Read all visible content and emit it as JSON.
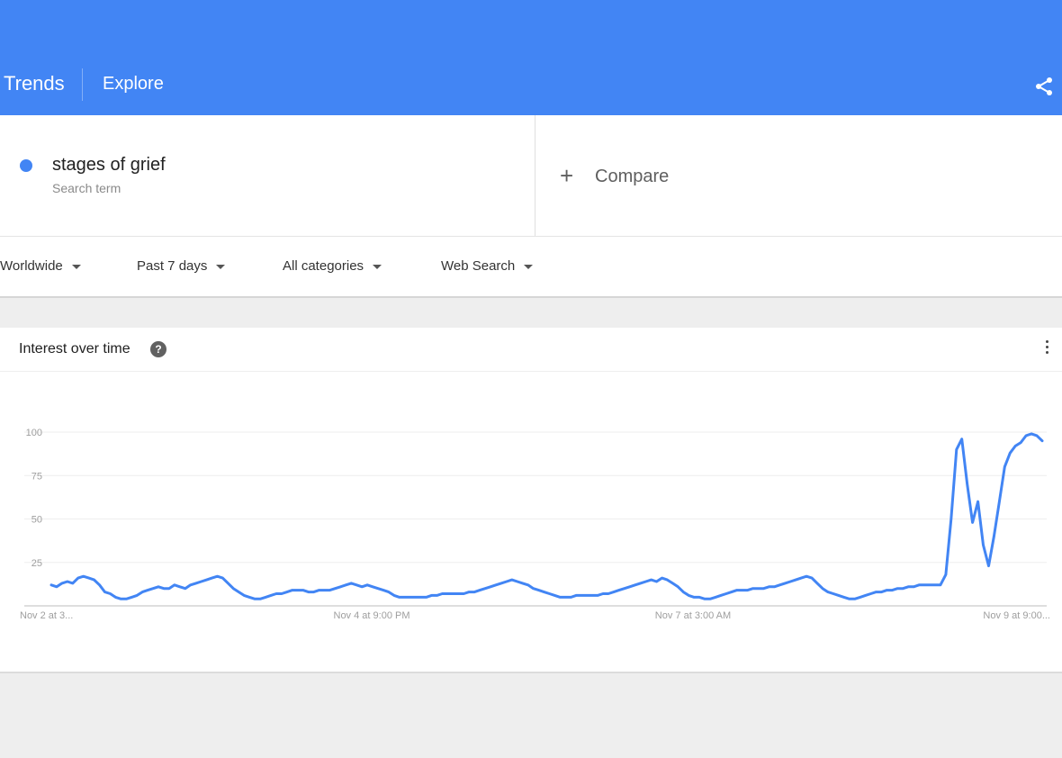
{
  "app": {
    "brand": "Trends",
    "nav_explore": "Explore"
  },
  "colors": {
    "header": "#4285f4",
    "series": "#4285f4"
  },
  "icons": {
    "share": "share-icon",
    "help": "help-icon",
    "more": "more-vert-icon",
    "add": "plus-icon",
    "dropdown": "caret-down-icon"
  },
  "search": {
    "term": "stages of grief",
    "term_type": "Search term",
    "compare_icon": "+",
    "compare_label": "Compare"
  },
  "filters": [
    {
      "label": "Worldwide"
    },
    {
      "label": "Past 7 days"
    },
    {
      "label": "All categories"
    },
    {
      "label": "Web Search"
    }
  ],
  "card": {
    "title": "Interest over time",
    "help_glyph": "?"
  },
  "chart_data": {
    "type": "line",
    "title": "Interest over time",
    "xlabel": "",
    "ylabel": "",
    "ylim": [
      0,
      100
    ],
    "yticks": [
      25,
      50,
      75,
      100
    ],
    "x_tick_labels": [
      "Nov 2 at 3...",
      "Nov 4 at 9:00 PM",
      "Nov 7 at 3:00 AM",
      "Nov 9 at 9:00..."
    ],
    "grid": true,
    "series": [
      {
        "values": [
          12,
          11,
          13,
          14,
          13,
          16,
          17,
          16,
          15,
          12,
          8,
          7,
          5,
          4,
          4,
          5,
          6,
          8,
          9,
          10,
          11,
          10,
          10,
          12,
          11,
          10,
          12,
          13,
          14,
          15,
          16,
          17,
          16,
          13,
          10,
          8,
          6,
          5,
          4,
          4,
          5,
          6,
          7,
          7,
          8,
          9,
          9,
          9,
          8,
          8,
          9,
          9,
          9,
          10,
          11,
          12,
          13,
          12,
          11,
          12,
          11,
          10,
          9,
          8,
          6,
          5,
          5,
          5,
          5,
          5,
          5,
          6,
          6,
          7,
          7,
          7,
          7,
          7,
          8,
          8,
          9,
          10,
          11,
          12,
          13,
          14,
          15,
          14,
          13,
          12,
          10,
          9,
          8,
          7,
          6,
          5,
          5,
          5,
          6,
          6,
          6,
          6,
          6,
          7,
          7,
          8,
          9,
          10,
          11,
          12,
          13,
          14,
          15,
          14,
          16,
          15,
          13,
          11,
          8,
          6,
          5,
          5,
          4,
          4,
          5,
          6,
          7,
          8,
          9,
          9,
          9,
          10,
          10,
          10,
          11,
          11,
          12,
          13,
          14,
          15,
          16,
          17,
          16,
          13,
          10,
          8,
          7,
          6,
          5,
          4,
          4,
          5,
          6,
          7,
          8,
          8,
          9,
          9,
          10,
          10,
          11,
          11,
          12,
          12,
          12,
          12,
          12,
          18,
          50,
          90,
          96,
          70,
          48,
          60,
          35,
          23,
          40,
          60,
          80,
          88,
          92,
          94,
          98,
          99,
          98,
          95
        ]
      }
    ]
  }
}
